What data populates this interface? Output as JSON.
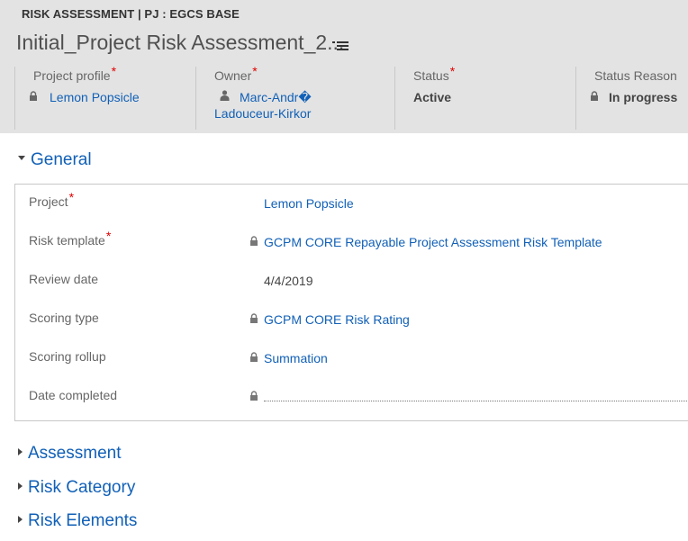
{
  "header": {
    "entity_type": "RISK ASSESSMENT | PJ : EGCS BASE",
    "record_title": "Initial_Project Risk Assessment_2...",
    "fields": [
      {
        "label": "Project profile",
        "required": "*",
        "value": "Lemon Popsicle",
        "icon": "lock-icon"
      },
      {
        "label": "Owner",
        "required": "*",
        "value_line1": "Marc-Andr�",
        "value_line2": "Ladouceur-Kirkor",
        "icon": "user-icon"
      },
      {
        "label": "Status",
        "required": "*",
        "value": "Active"
      },
      {
        "label": "Status Reason",
        "value": "In progress",
        "icon": "lock-icon"
      }
    ]
  },
  "sections": {
    "general": {
      "title": "General",
      "fields": [
        {
          "label": "Project",
          "required": "*",
          "value": "Lemon Popsicle",
          "locked": false
        },
        {
          "label": "Risk template",
          "required": "*",
          "value": "GCPM CORE Repayable Project Assessment Risk Template",
          "locked": true
        },
        {
          "label": "Review date",
          "value": "4/4/2019",
          "locked": false
        },
        {
          "label": "Scoring type",
          "value": "GCPM CORE Risk Rating",
          "locked": true
        },
        {
          "label": "Scoring rollup",
          "value": "Summation",
          "locked": true
        },
        {
          "label": "Date completed",
          "value": "",
          "locked": true
        }
      ]
    },
    "assessment": {
      "title": "Assessment"
    },
    "risk_category": {
      "title": "Risk Category"
    },
    "risk_elements": {
      "title": "Risk Elements"
    }
  },
  "colors": {
    "link": "#1160b7",
    "required": "#e00000",
    "header_bg": "#e3e3e3"
  }
}
